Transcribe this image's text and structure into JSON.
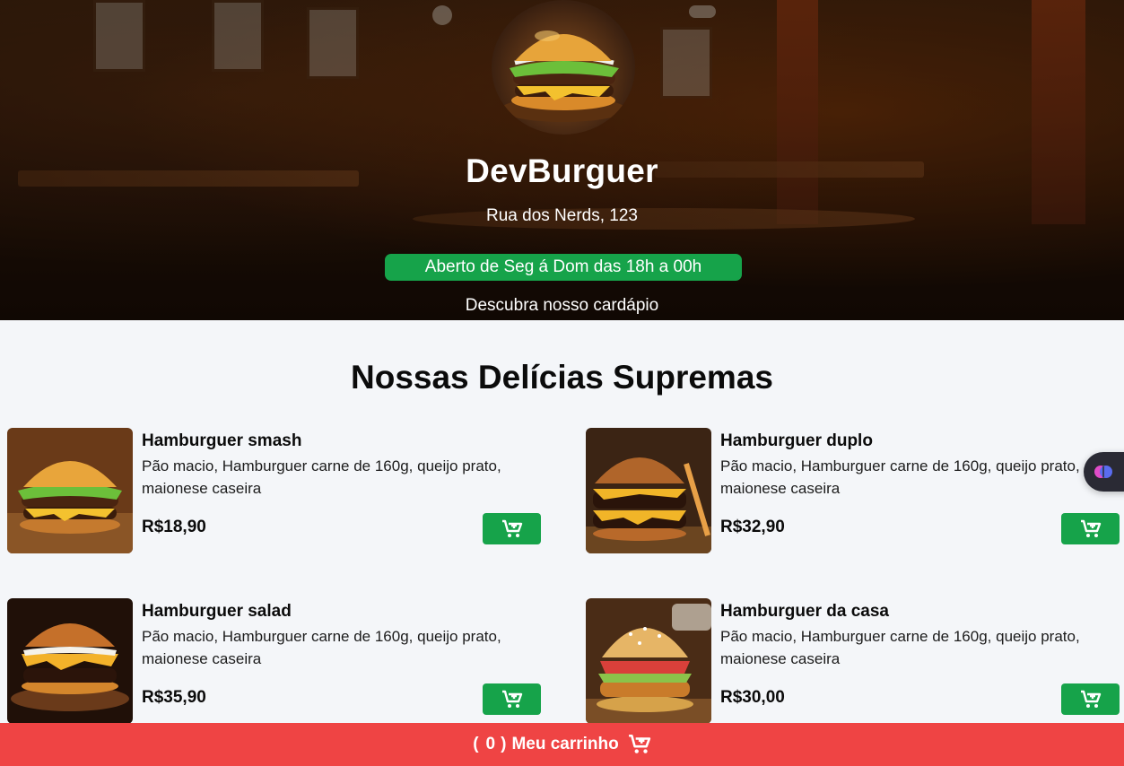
{
  "header": {
    "title": "DevBurguer",
    "address": "Rua dos Nerds, 123",
    "hours": "Aberto de Seg á Dom das 18h a 00h",
    "cta": "Descubra nosso cardápio"
  },
  "menu": {
    "title": "Nossas Delícias Supremas",
    "items": [
      {
        "name": "Hamburguer smash",
        "description": "Pão macio, Hamburguer carne de 160g, queijo prato, maionese caseira",
        "price": "R$18,90"
      },
      {
        "name": "Hamburguer duplo",
        "description": "Pão macio, Hamburguer carne de 160g, queijo prato, maionese caseira",
        "price": "R$32,90"
      },
      {
        "name": "Hamburguer salad",
        "description": "Pão macio, Hamburguer carne de 160g, queijo prato, maionese caseira",
        "price": "R$35,90"
      },
      {
        "name": "Hamburguer da casa",
        "description": "Pão macio, Hamburguer carne de 160g, queijo prato, maionese caseira",
        "price": "R$30,00"
      }
    ]
  },
  "cart": {
    "open_paren": "(",
    "count": "0",
    "close_paren": ")",
    "label": "Meu carrinho"
  },
  "icons": {
    "add_to_cart": "cart-plus-icon",
    "widget": "brain-icon"
  },
  "colors": {
    "accent_green": "#16a34a",
    "cart_red": "#ef4444",
    "background": "#f4f6f9"
  }
}
